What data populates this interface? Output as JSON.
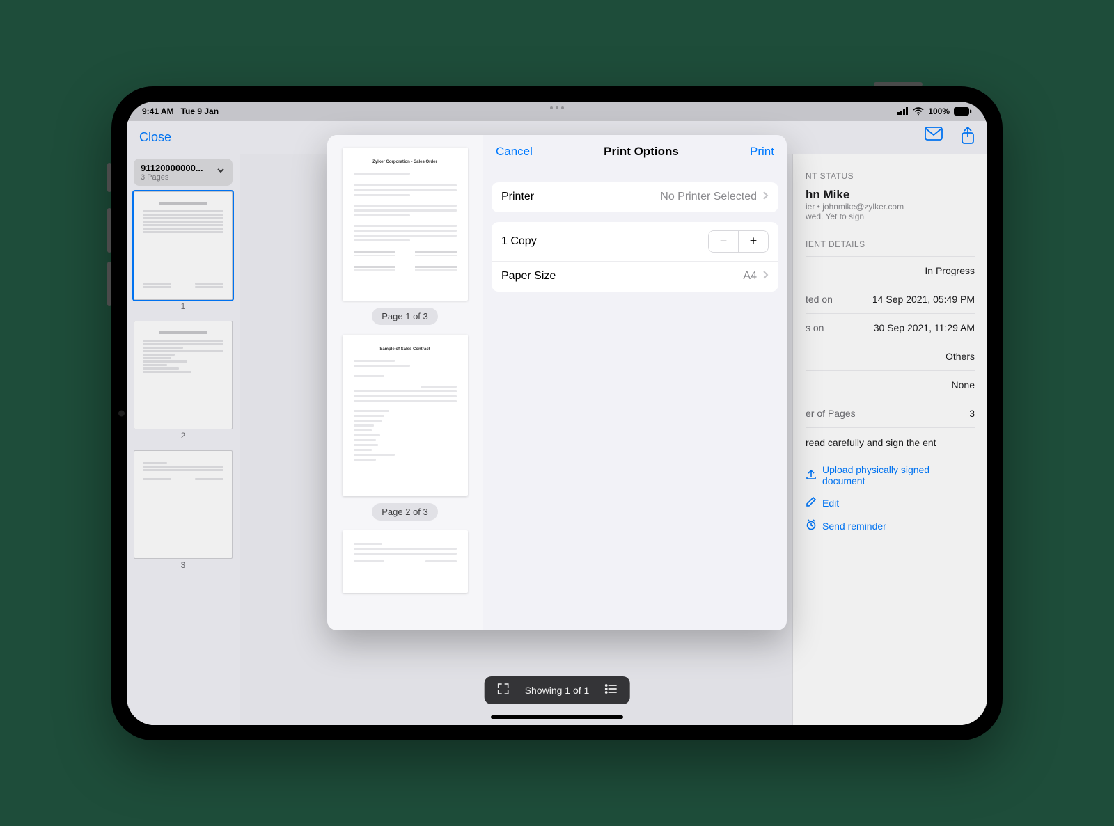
{
  "statusbar": {
    "time": "9:41 AM",
    "date": "Tue 9 Jan",
    "battery": "100%"
  },
  "header": {
    "close_label": "Close"
  },
  "doc_picker": {
    "title": "91120000000...",
    "subtitle": "3 Pages"
  },
  "thumb_labels": {
    "p1": "1",
    "p2": "2",
    "p3": "3"
  },
  "toolbar": {
    "counter": "Showing 1 of 1"
  },
  "sheet": {
    "cancel_label": "Cancel",
    "title": "Print Options",
    "print_label": "Print",
    "printer_key": "Printer",
    "printer_val": "No Printer Selected",
    "copies_label": "1 Copy",
    "paper_key": "Paper Size",
    "paper_val": "A4",
    "preview_page1_title": "Zylker Corporation - Sales Order",
    "preview_page2_title": "Sample of Sales Contract",
    "page1_badge": "Page 1 of 3",
    "page2_badge": "Page 2 of 3"
  },
  "details": {
    "status_section": "NT STATUS",
    "owner_name": "hn Mike",
    "owner_sub": "ier • johnmike@zylker.com",
    "owner_sub2": "wed. Yet to sign",
    "details_section": "IENT DETAILS",
    "rows": [
      {
        "k": "",
        "v": "In Progress"
      },
      {
        "k": "ted on",
        "v": "14 Sep 2021, 05:49 PM"
      },
      {
        "k": "s on",
        "v": "30 Sep 2021, 11:29 AM"
      },
      {
        "k": "",
        "v": "Others"
      },
      {
        "k": "",
        "v": "None"
      },
      {
        "k": "er of Pages",
        "v": "3"
      }
    ],
    "note": "read carefully and sign the ent",
    "action_upload": "Upload physically signed document",
    "action_edit": "Edit",
    "action_remind": "Send reminder"
  }
}
